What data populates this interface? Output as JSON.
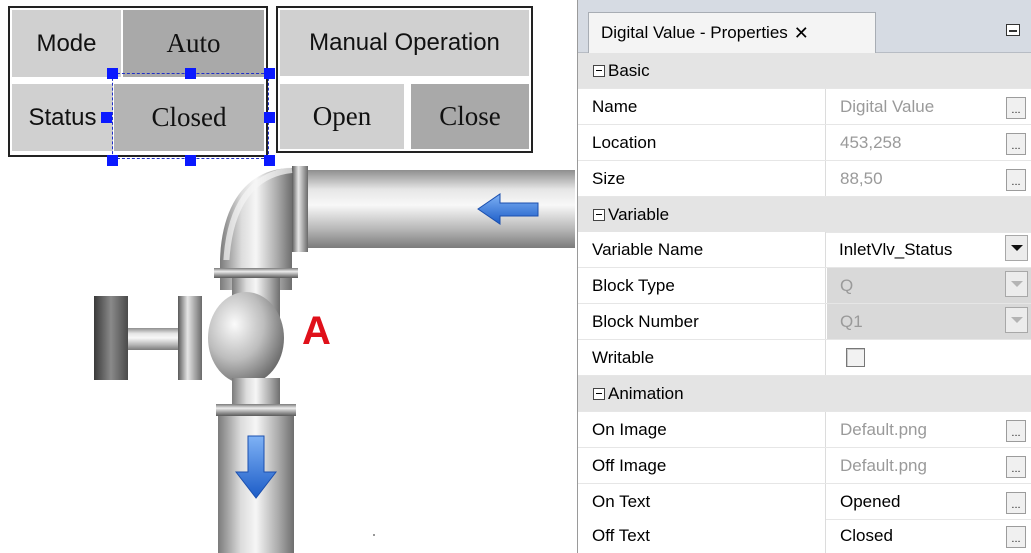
{
  "control_panel": {
    "mode_label": "Mode",
    "mode_value": "Auto",
    "status_label": "Status",
    "status_value": "Closed",
    "manual_title": "Manual Operation",
    "open_button": "Open",
    "close_button": "Close"
  },
  "diagram": {
    "valve_marker": "A"
  },
  "properties": {
    "tab_title": "Digital Value - Properties",
    "tab_close_glyph": "✕",
    "categories": {
      "basic": "Basic",
      "variable": "Variable",
      "animation": "Animation"
    },
    "rows": {
      "name": {
        "label": "Name",
        "value": "Digital Value"
      },
      "location": {
        "label": "Location",
        "value": "453,258"
      },
      "size": {
        "label": "Size",
        "value": "88,50"
      },
      "variable_name": {
        "label": "Variable Name",
        "value": "InletVlv_Status"
      },
      "block_type": {
        "label": "Block Type",
        "value": "Q"
      },
      "block_number": {
        "label": "Block Number",
        "value": "Q1"
      },
      "writable": {
        "label": "Writable",
        "checked": false
      },
      "on_image": {
        "label": "On Image",
        "value": "Default.png"
      },
      "off_image": {
        "label": "Off Image",
        "value": "Default.png"
      },
      "on_text": {
        "label": "On Text",
        "value": "Opened"
      },
      "off_text": {
        "label": "Off Text",
        "value": "Closed"
      }
    },
    "ellipsis_glyph": "..."
  },
  "colors": {
    "selection_handle": "#0a19ff",
    "marker_red": "#e0101a",
    "flow_arrow_blue": "#2f6fd8"
  }
}
